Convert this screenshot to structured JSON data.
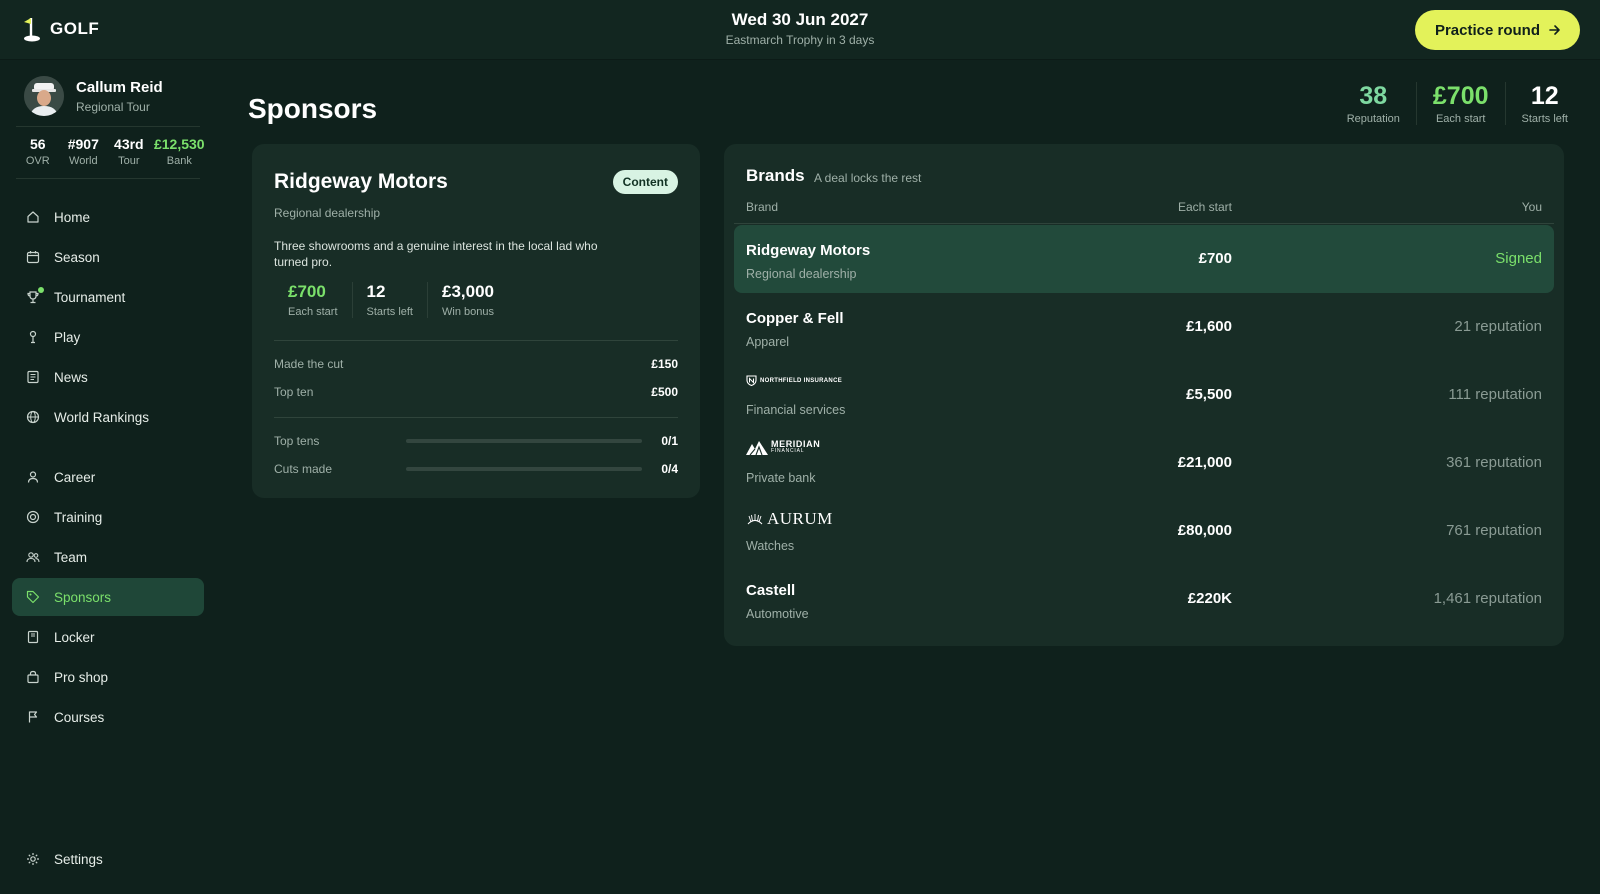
{
  "app": {
    "logo_text": "GOLF"
  },
  "header": {
    "date": "Wed 30 Jun 2027",
    "next_event": "Eastmarch Trophy in 3 days",
    "practice_label": "Practice round"
  },
  "profile": {
    "name": "Callum Reid",
    "tour": "Regional Tour",
    "stats": [
      {
        "value": "56",
        "label": "OVR"
      },
      {
        "value": "#907",
        "label": "World"
      },
      {
        "value": "43rd",
        "label": "Tour"
      },
      {
        "value": "£12,530",
        "label": "Bank"
      }
    ]
  },
  "nav": {
    "items": [
      {
        "label": "Home",
        "icon": "home-icon"
      },
      {
        "label": "Season",
        "icon": "calendar-icon"
      },
      {
        "label": "Tournament",
        "icon": "trophy-icon"
      },
      {
        "label": "Play",
        "icon": "golf-tee-icon"
      },
      {
        "label": "News",
        "icon": "news-icon"
      },
      {
        "label": "World Rankings",
        "icon": "globe-icon"
      },
      {
        "label": "Career",
        "icon": "person-icon"
      },
      {
        "label": "Training",
        "icon": "target-icon"
      },
      {
        "label": "Team",
        "icon": "team-icon"
      },
      {
        "label": "Sponsors",
        "icon": "tag-icon"
      },
      {
        "label": "Locker",
        "icon": "locker-icon"
      },
      {
        "label": "Pro shop",
        "icon": "shopping-bag-icon"
      },
      {
        "label": "Courses",
        "icon": "flag-icon"
      }
    ],
    "active": "Sponsors",
    "settings_label": "Settings"
  },
  "page": {
    "title": "Sponsors",
    "header_stats": [
      {
        "value": "38",
        "label": "Reputation",
        "color": "#7ed8a0"
      },
      {
        "value": "£700",
        "label": "Each start",
        "color": "#7be06b"
      },
      {
        "value": "12",
        "label": "Starts left",
        "color": "#ffffff"
      }
    ]
  },
  "deal": {
    "name": "Ridgeway Motors",
    "badge": "Content",
    "category": "Regional dealership",
    "description": "Three showrooms and a genuine interest in the local lad who turned pro.",
    "stats": [
      {
        "value": "£700",
        "label": "Each start",
        "color": "#7be06b"
      },
      {
        "value": "12",
        "label": "Starts left",
        "color": "#ffffff"
      },
      {
        "value": "£3,000",
        "label": "Win bonus",
        "color": "#ffffff"
      }
    ],
    "bonuses": [
      {
        "label": "Made the cut",
        "value": "£150"
      },
      {
        "label": "Top ten",
        "value": "£500"
      }
    ],
    "progress": [
      {
        "label": "Top tens",
        "value": "0/1",
        "fraction": 0.0
      },
      {
        "label": "Cuts made",
        "value": "0/4",
        "fraction": 0.0
      }
    ]
  },
  "brands": {
    "title": "Brands",
    "subtitle": "A deal locks the rest",
    "columns": {
      "brand": "Brand",
      "each_start": "Each start",
      "you": "You"
    },
    "rows": [
      {
        "name": "Ridgeway Motors",
        "category": "Regional dealership",
        "each_start": "£700",
        "you": "Signed",
        "signed": true,
        "logo": null
      },
      {
        "name": "Copper & Fell",
        "category": "Apparel",
        "each_start": "£1,600",
        "you": "21 reputation",
        "signed": false,
        "logo": null
      },
      {
        "name": "NORTHFIELD INSURANCE",
        "category": "Financial services",
        "each_start": "£5,500",
        "you": "111 reputation",
        "signed": false,
        "logo": "northfield-logo"
      },
      {
        "name": "MERIDIAN",
        "logo_sub": "FINANCIAL",
        "category": "Private bank",
        "each_start": "£21,000",
        "you": "361 reputation",
        "signed": false,
        "logo": "meridian-logo"
      },
      {
        "name": "AURUM",
        "category": "Watches",
        "each_start": "£80,000",
        "you": "761 reputation",
        "signed": false,
        "logo": "aurum-logo"
      },
      {
        "name": "Castell",
        "category": "Automotive",
        "each_start": "£220K",
        "you": "1,461 reputation",
        "signed": false,
        "logo": null
      }
    ]
  }
}
